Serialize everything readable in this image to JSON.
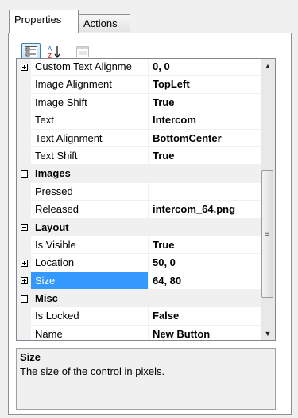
{
  "tabs": [
    {
      "label": "Properties",
      "active": true
    },
    {
      "label": "Actions",
      "active": false
    }
  ],
  "toolbar": {
    "categorized_icon": "categorized-view-icon",
    "alphabetical_icon": "sort-az-icon",
    "property_pages_icon": "property-pages-icon"
  },
  "rows": [
    {
      "type": "property",
      "expander": "plus",
      "name": "Custom Text Alignme",
      "value": "0, 0"
    },
    {
      "type": "property",
      "expander": "",
      "name": "Image Alignment",
      "value": "TopLeft"
    },
    {
      "type": "property",
      "expander": "",
      "name": "Image Shift",
      "value": "True"
    },
    {
      "type": "property",
      "expander": "",
      "name": "Text",
      "value": "Intercom"
    },
    {
      "type": "property",
      "expander": "",
      "name": "Text Alignment",
      "value": "BottomCenter"
    },
    {
      "type": "property",
      "expander": "",
      "name": "Text Shift",
      "value": "True"
    },
    {
      "type": "category",
      "expander": "minus",
      "name": "Images",
      "value": ""
    },
    {
      "type": "property",
      "expander": "",
      "name": "Pressed",
      "value": ""
    },
    {
      "type": "property",
      "expander": "",
      "name": "Released",
      "value": "intercom_64.png"
    },
    {
      "type": "category",
      "expander": "minus",
      "name": "Layout",
      "value": ""
    },
    {
      "type": "property",
      "expander": "",
      "name": "Is Visible",
      "value": "True"
    },
    {
      "type": "property",
      "expander": "plus",
      "name": "Location",
      "value": "50, 0"
    },
    {
      "type": "property",
      "expander": "plus",
      "name": "Size",
      "value": "64, 80",
      "selected": true
    },
    {
      "type": "category",
      "expander": "minus",
      "name": "Misc",
      "value": ""
    },
    {
      "type": "property",
      "expander": "",
      "name": "Is Locked",
      "value": "False"
    },
    {
      "type": "property",
      "expander": "",
      "name": "Name",
      "value": "New Button"
    }
  ],
  "help": {
    "title": "Size",
    "description": "The size of the control in pixels."
  },
  "colors": {
    "selection": "#3399ff",
    "gutter": "#f0f0f0"
  }
}
